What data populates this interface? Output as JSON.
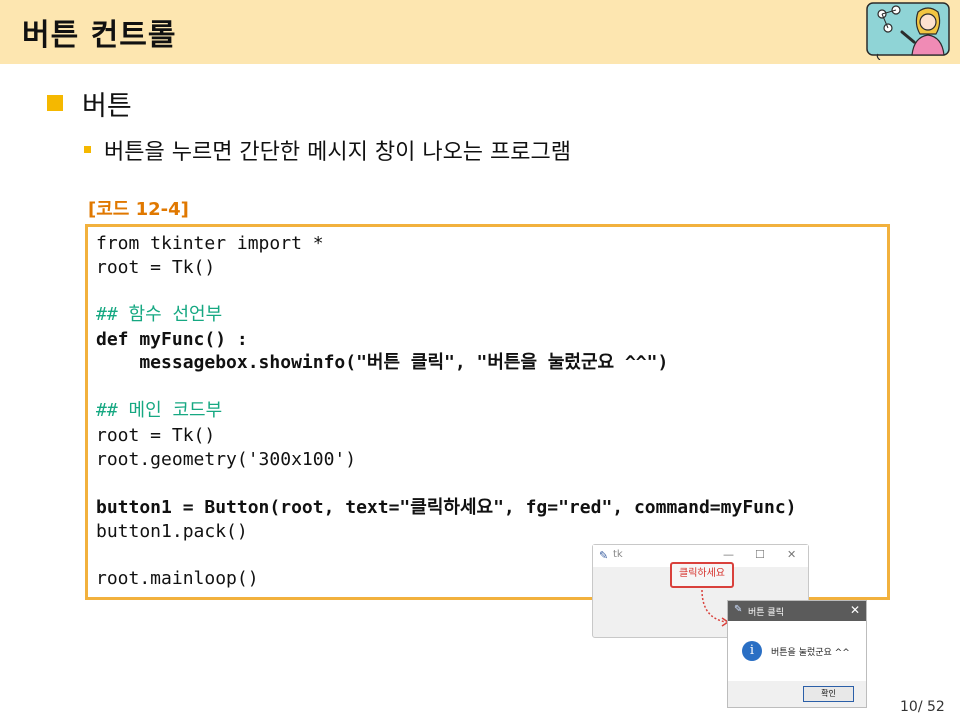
{
  "slide": {
    "title": "버튼 컨트롤",
    "bullet1": "버튼",
    "bullet2": "버튼을 누르면 간단한 메시지 창이 나오는 프로그램",
    "code_caption": "[코드 12-4]",
    "page_number": "10/ 52"
  },
  "code_lines": [
    {
      "text": "from tkinter import *",
      "style": "normal"
    },
    {
      "text": "root = Tk()",
      "style": "normal"
    },
    {
      "text": "## 함수 선언부",
      "style": "comment"
    },
    {
      "text": "def myFunc() :",
      "style": "bold"
    },
    {
      "text": "    messagebox.showinfo(\"버튼 클릭\", \"버튼을 눌렀군요 ^^\")",
      "style": "bold"
    },
    {
      "text": "## 메인 코드부",
      "style": "comment"
    },
    {
      "text": "root = Tk()",
      "style": "normal"
    },
    {
      "text": "root.geometry('300x100')",
      "style": "normal"
    },
    {
      "text": "button1 = Button(root, text=\"클릭하세요\", fg=\"red\", command=myFunc)",
      "style": "bold"
    },
    {
      "text": "button1.pack()",
      "style": "normal"
    },
    {
      "text": "root.mainloop()",
      "style": "normal"
    }
  ],
  "tk_window": {
    "title": "tk",
    "minimize": "—",
    "maximize": "☐",
    "close": "✕",
    "button_label": "클릭하세요"
  },
  "message_box": {
    "title": "버튼 클릭",
    "close": "✕",
    "icon": "i",
    "message": "버튼을 눌렀군요 ^^",
    "ok_label": "확인"
  },
  "colors": {
    "header_bg": "#fde6b0",
    "accent": "#f5b800",
    "code_border": "#f2b13d",
    "caption": "#e07800",
    "comment": "#16a882",
    "button_text": "#d6302a"
  }
}
